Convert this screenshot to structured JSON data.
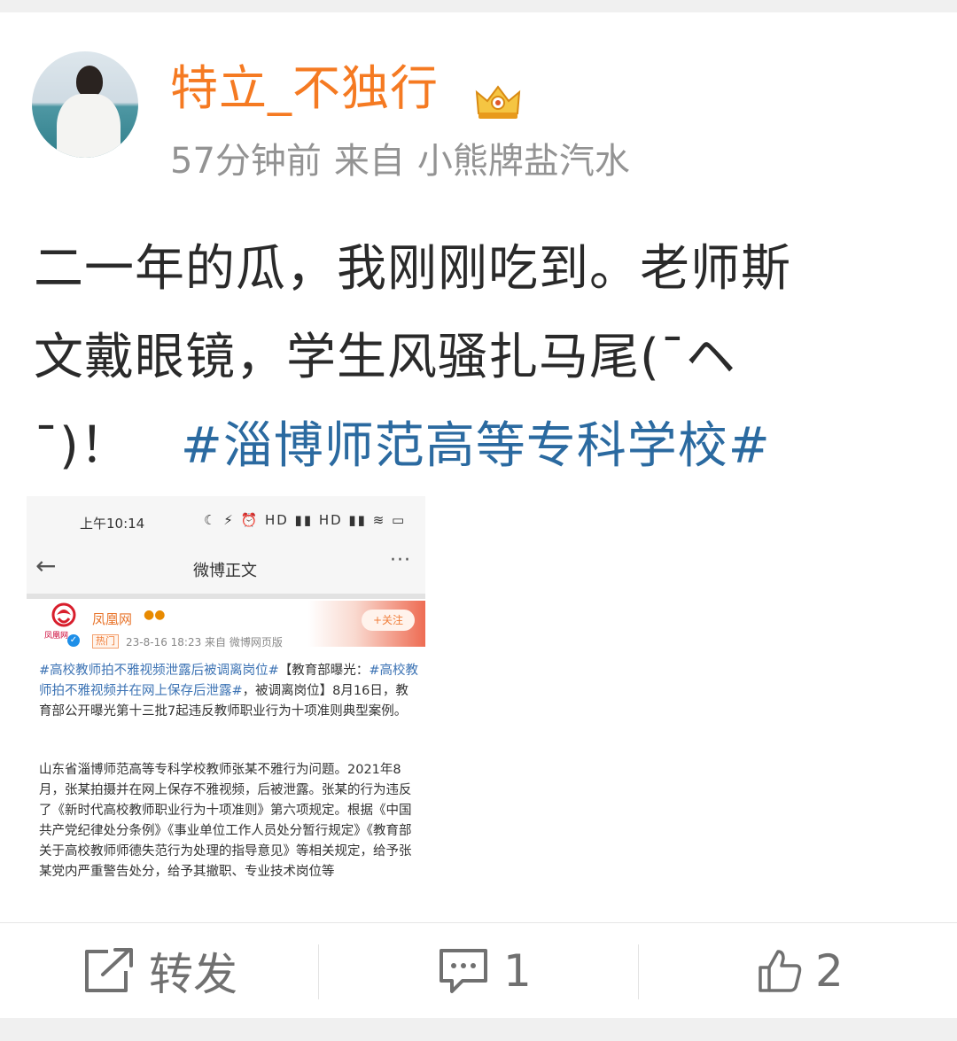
{
  "post": {
    "username": "特立_不独行",
    "time_ago": "57分钟前",
    "source_prefix": "来自",
    "source": "小熊牌盐汽水",
    "content_lines": [
      "二一年的瓜，我刚刚吃到。老师斯",
      "文戴眼镜，学生风骚扎马尾(ˉ",
      "ˉ)！"
    ],
    "content_arrow": "ヘ",
    "hashtag": "#淄博师范高等专科学校#"
  },
  "image": {
    "status_time": "上午10:14",
    "status_icons": "☾ ⚡ ⏰ HD ▮▮ HD ▮▮ ≋ ▭",
    "nav_title": "微博正文",
    "back_glyph": "←",
    "more_glyph": "···",
    "source_name": "凤凰网",
    "source_badges": "●●",
    "hot_tag": "热门",
    "source_meta": "23-8-16 18:23  来自 微博网页版",
    "follow_label": "+关注",
    "logo_sub": "凤凰网",
    "para1_tag1": "#高校教师拍不雅视频泄露后被调离岗位#",
    "para1_text1": "【教育部曝光：",
    "para1_tag2": "#高校教师拍不雅视频并在网上保存后泄露#",
    "para1_text2": "，被调离岗位】8月16日，教育部公开曝光第十三批7起违反教师职业行为十项准则典型案例。",
    "para2": "山东省淄博师范高等专科学校教师张某不雅行为问题。2021年8月，张某拍摄并在网上保存不雅视频，后被泄露。张某的行为违反了《新时代高校教师职业行为十项准则》第六项规定。根据《中国共产党纪律处分条例》《事业单位工作人员处分暂行规定》《教育部关于高校教师师德失范行为处理的指导意见》等相关规定，给予张某党内严重警告处分，给予其撤职、专业技术岗位等"
  },
  "actions": {
    "repost_label": "转发",
    "comment_count": "1",
    "like_count": "2"
  },
  "colors": {
    "username": "#f57a22",
    "hashtag": "#2b6aa0",
    "meta": "#939393"
  }
}
